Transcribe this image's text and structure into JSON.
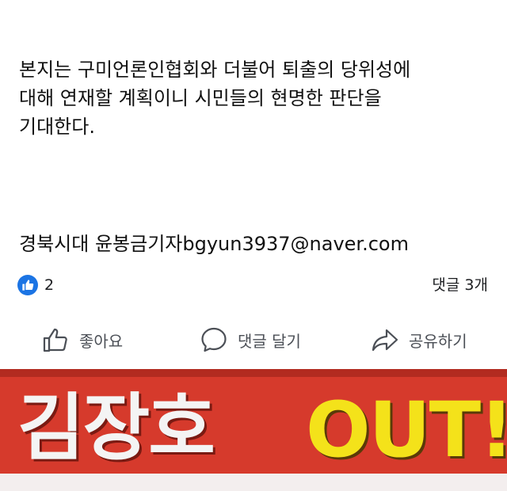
{
  "post": {
    "body_lines": [
      "본지는 구미언론인협회와 더불어 퇴출의 당위성에",
      "대해 연재할 계획이니 시민들의 현명한 판단을",
      "기대한다."
    ],
    "signature": "경북시대 윤봉금기자bgyun3937@naver.com"
  },
  "stats": {
    "like_icon": "thumbs-up-icon",
    "like_count": "2",
    "comment_count": "댓글 3개"
  },
  "actions": {
    "like_label": "좋아요",
    "comment_label": "댓글 달기",
    "share_label": "공유하기"
  },
  "banner": {
    "name_text": "김장호",
    "out_text": "OUT!"
  },
  "colors": {
    "like_blue": "#1b74e4",
    "banner_red": "#d63a2c",
    "banner_yellow": "#f4e21a"
  }
}
